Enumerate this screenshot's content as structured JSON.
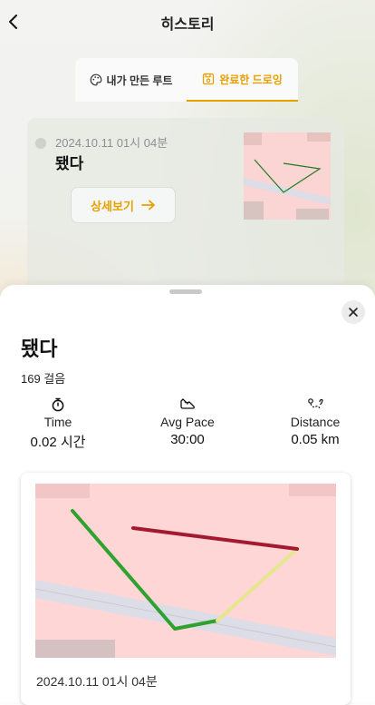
{
  "header": {
    "title": "히스토리",
    "back_icon": "chevron-left-icon"
  },
  "tabs": [
    {
      "label": "내가 만든 루트",
      "icon": "palette-icon",
      "active": false
    },
    {
      "label": "완료한 드로잉",
      "icon": "save-icon",
      "active": true
    }
  ],
  "history_card": {
    "date": "2024.10.11 01시 04분",
    "title": "됐다",
    "detail_button": "상세보기",
    "detail_icon": "arrow-right-icon"
  },
  "sheet": {
    "title": "됐다",
    "steps": "169 걸음",
    "stats": [
      {
        "label": "Time",
        "value": "0.02 시간",
        "icon": "stopwatch-icon"
      },
      {
        "label": "Avg Pace",
        "value": "30:00",
        "icon": "running-shoe-icon"
      },
      {
        "label": "Distance",
        "value": "0.05 km",
        "icon": "route-icon"
      }
    ],
    "map_date": "2024.10.11 01시 04분"
  },
  "colors": {
    "accent": "#e7a000",
    "map_background": "#ffd6d6",
    "road": "#dcdde7",
    "route_green": "#2ea12e",
    "route_yellow": "#e6e68f",
    "route_red": "#a3192f"
  }
}
